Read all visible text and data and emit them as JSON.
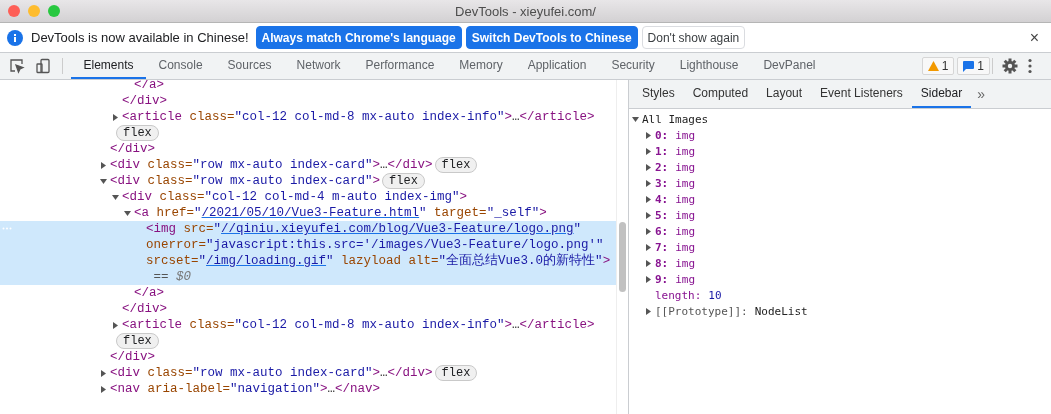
{
  "window": {
    "title": "DevTools - xieyufei.com/"
  },
  "infobar": {
    "message": "DevTools is now available in Chinese!",
    "buttons": [
      {
        "label": "Always match Chrome's language",
        "kind": "primary"
      },
      {
        "label": "Switch DevTools to Chinese",
        "kind": "primary"
      },
      {
        "label": "Don't show again",
        "kind": "secondary"
      }
    ],
    "close": "×"
  },
  "toolbar": {
    "tabs": [
      {
        "label": "Elements",
        "selected": true
      },
      {
        "label": "Console",
        "selected": false
      },
      {
        "label": "Sources",
        "selected": false
      },
      {
        "label": "Network",
        "selected": false
      },
      {
        "label": "Performance",
        "selected": false
      },
      {
        "label": "Memory",
        "selected": false
      },
      {
        "label": "Application",
        "selected": false
      },
      {
        "label": "Security",
        "selected": false
      },
      {
        "label": "Lighthouse",
        "selected": false
      },
      {
        "label": "DevPanel",
        "selected": false
      }
    ],
    "warnings": "1",
    "messages": "1"
  },
  "elements": {
    "nodes": [
      {
        "children": [
          {
            "children": [
              {
                "lines": [
                  [
                    {
                      "kind": "tag",
                      "text": "</a>"
                    }
                  ]
                ],
                "selected": false
              }
            ]
          },
          {
            "lines": [
              [
                {
                  "kind": "tag",
                  "text": "</div>"
                }
              ]
            ],
            "selected": false
          },
          {
            "expanded": false,
            "selected": false,
            "lines": [
              [
                {
                  "kind": "tag",
                  "text": "<article"
                },
                {
                  "kind": "attr",
                  "text": " class="
                },
                {
                  "kind": "value",
                  "text": "\"col-12 col-md-8 mx-auto index-info\""
                },
                {
                  "kind": "tag",
                  "text": ">"
                },
                {
                  "kind": "ellipsis",
                  "text": "…"
                },
                {
                  "kind": "tag",
                  "text": "</article>"
                }
              ],
              [
                {
                  "kind": "badge",
                  "text": "flex"
                }
              ]
            ]
          }
        ]
      },
      {
        "lines": [
          [
            {
              "kind": "tag",
              "text": "</div>"
            }
          ]
        ],
        "selected": false
      },
      {
        "expanded": false,
        "selected": false,
        "lines": [
          [
            {
              "kind": "tag",
              "text": "<div"
            },
            {
              "kind": "attr",
              "text": " class="
            },
            {
              "kind": "value",
              "text": "\"row mx-auto index-card\""
            },
            {
              "kind": "tag",
              "text": ">"
            },
            {
              "kind": "ellipsis",
              "text": "…"
            },
            {
              "kind": "tag",
              "text": "</div>"
            },
            {
              "kind": "badge",
              "text": "flex"
            }
          ]
        ]
      },
      {
        "expanded": true,
        "selected": false,
        "lines": [
          [
            {
              "kind": "tag",
              "text": "<div"
            },
            {
              "kind": "attr",
              "text": " class="
            },
            {
              "kind": "value",
              "text": "\"row mx-auto index-card\""
            },
            {
              "kind": "tag",
              "text": ">"
            },
            {
              "kind": "badge",
              "text": "flex"
            }
          ]
        ],
        "children": [
          {
            "expanded": true,
            "selected": false,
            "lines": [
              [
                {
                  "kind": "tag",
                  "text": "<div"
                },
                {
                  "kind": "attr",
                  "text": " class="
                },
                {
                  "kind": "value",
                  "text": "\"col-12 col-md-4 m-auto index-img\""
                },
                {
                  "kind": "tag",
                  "text": ">"
                }
              ]
            ],
            "children": [
              {
                "expanded": true,
                "selected": false,
                "lines": [
                  [
                    {
                      "kind": "tag",
                      "text": "<a"
                    },
                    {
                      "kind": "attr",
                      "text": " href="
                    },
                    {
                      "kind": "value",
                      "text": "\""
                    },
                    {
                      "kind": "link",
                      "text": "/2021/05/10/Vue3-Feature.html"
                    },
                    {
                      "kind": "value",
                      "text": "\""
                    },
                    {
                      "kind": "attr",
                      "text": " target="
                    },
                    {
                      "kind": "value",
                      "text": "\"_self\""
                    },
                    {
                      "kind": "tag",
                      "text": ">"
                    }
                  ]
                ],
                "children": [
                  {
                    "selected": true,
                    "lines": [
                      [
                        {
                          "kind": "tag",
                          "text": "<img"
                        },
                        {
                          "kind": "attr",
                          "text": " src="
                        },
                        {
                          "kind": "value",
                          "text": "\""
                        },
                        {
                          "kind": "link",
                          "text": "//qiniu.xieyufei.com/blog/Vue3-Feature/logo.png"
                        },
                        {
                          "kind": "value",
                          "text": "\""
                        }
                      ],
                      [
                        {
                          "kind": "attr",
                          "text": "onerror="
                        },
                        {
                          "kind": "value",
                          "text": "\"javascript:this.src='/images/Vue3-Feature/logo.png'\""
                        }
                      ],
                      [
                        {
                          "kind": "attr",
                          "text": "srcset="
                        },
                        {
                          "kind": "value",
                          "text": "\""
                        },
                        {
                          "kind": "link",
                          "text": "/img/loading.gif"
                        },
                        {
                          "kind": "value",
                          "text": "\""
                        },
                        {
                          "kind": "attr",
                          "text": " lazyload alt="
                        },
                        {
                          "kind": "value",
                          "text": "\"全面总结Vue3.0的新特性\""
                        },
                        {
                          "kind": "tag",
                          "text": ">"
                        }
                      ],
                      [
                        {
                          "kind": "plain",
                          "text": " == "
                        },
                        {
                          "kind": "dollar",
                          "text": "$0"
                        }
                      ]
                    ]
                  }
                ]
              },
              {
                "lines": [
                  [
                    {
                      "kind": "tag",
                      "text": "</a>"
                    }
                  ]
                ],
                "selected": false
              }
            ]
          },
          {
            "lines": [
              [
                {
                  "kind": "tag",
                  "text": "</div>"
                }
              ]
            ],
            "selected": false
          },
          {
            "expanded": false,
            "selected": false,
            "lines": [
              [
                {
                  "kind": "tag",
                  "text": "<article"
                },
                {
                  "kind": "attr",
                  "text": " class="
                },
                {
                  "kind": "value",
                  "text": "\"col-12 col-md-8 mx-auto index-info\""
                },
                {
                  "kind": "tag",
                  "text": ">"
                },
                {
                  "kind": "ellipsis",
                  "text": "…"
                },
                {
                  "kind": "tag",
                  "text": "</article>"
                }
              ],
              [
                {
                  "kind": "badge",
                  "text": "flex"
                }
              ]
            ]
          }
        ]
      },
      {
        "lines": [
          [
            {
              "kind": "tag",
              "text": "</div>"
            }
          ]
        ],
        "selected": false
      },
      {
        "expanded": false,
        "selected": false,
        "lines": [
          [
            {
              "kind": "tag",
              "text": "<div"
            },
            {
              "kind": "attr",
              "text": " class="
            },
            {
              "kind": "value",
              "text": "\"row mx-auto index-card\""
            },
            {
              "kind": "tag",
              "text": ">"
            },
            {
              "kind": "ellipsis",
              "text": "…"
            },
            {
              "kind": "tag",
              "text": "</div>"
            },
            {
              "kind": "badge",
              "text": "flex"
            }
          ]
        ]
      },
      {
        "expanded": false,
        "selected": false,
        "lines": [
          [
            {
              "kind": "tag",
              "text": "<nav"
            },
            {
              "kind": "attr",
              "text": " aria-label="
            },
            {
              "kind": "value",
              "text": "\"navigation\""
            },
            {
              "kind": "tag",
              "text": ">"
            },
            {
              "kind": "ellipsis",
              "text": "…"
            },
            {
              "kind": "tag",
              "text": "</nav>"
            }
          ]
        ]
      }
    ]
  },
  "sidebar": {
    "tabs": [
      {
        "label": "Styles",
        "selected": false
      },
      {
        "label": "Computed",
        "selected": false
      },
      {
        "label": "Layout",
        "selected": false
      },
      {
        "label": "Event Listeners",
        "selected": false
      },
      {
        "label": "Sidebar",
        "selected": true
      }
    ],
    "more": "»",
    "tree": {
      "label": "All Images",
      "expanded": true,
      "children": [
        {
          "key": "0:",
          "value": "img",
          "kind": "element",
          "expanded": false
        },
        {
          "key": "1:",
          "value": "img",
          "kind": "element",
          "expanded": false
        },
        {
          "key": "2:",
          "value": "img",
          "kind": "element",
          "expanded": false
        },
        {
          "key": "3:",
          "value": "img",
          "kind": "element",
          "expanded": false
        },
        {
          "key": "4:",
          "value": "img",
          "kind": "element",
          "expanded": false
        },
        {
          "key": "5:",
          "value": "img",
          "kind": "element",
          "expanded": false
        },
        {
          "key": "6:",
          "value": "img",
          "kind": "element",
          "expanded": false
        },
        {
          "key": "7:",
          "value": "img",
          "kind": "element",
          "expanded": false
        },
        {
          "key": "8:",
          "value": "img",
          "kind": "element",
          "expanded": false
        },
        {
          "key": "9:",
          "value": "img",
          "kind": "element",
          "expanded": false
        },
        {
          "key": "length:",
          "value": "10",
          "kind": "number"
        },
        {
          "key": "[[Prototype]]:",
          "value": "NodeList",
          "kind": "prototype",
          "expanded": false
        }
      ]
    }
  }
}
